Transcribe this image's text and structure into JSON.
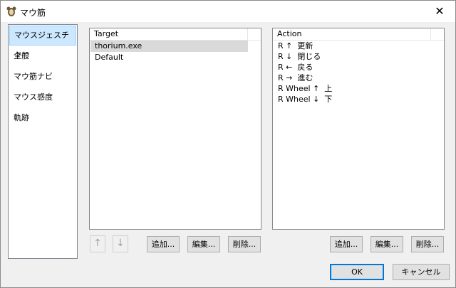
{
  "window": {
    "title": "マウ筋",
    "close_symbol": "✕",
    "icon": "mouse-app-icon"
  },
  "nav": {
    "items": [
      {
        "label": "マウスジェスチャー",
        "selected": true
      },
      {
        "label": "全般"
      },
      {
        "label": "マウ筋ナビ"
      },
      {
        "label": "マウス感度"
      },
      {
        "label": "軌跡"
      }
    ]
  },
  "targets": {
    "header": "Target",
    "rows": [
      "thorium.exe",
      "Default"
    ]
  },
  "actions": {
    "header": "Action",
    "rows": [
      "R ↑  更新",
      "R ↓  閉じる",
      "R ←  戻る",
      "R →  進む",
      "R Wheel ↑  上",
      "R Wheel ↓  下"
    ]
  },
  "target_buttons": {
    "up": "↑",
    "down": "↓",
    "add": "追加...",
    "edit": "編集...",
    "delete": "削除..."
  },
  "action_buttons": {
    "add": "追加...",
    "edit": "編集...",
    "delete": "削除..."
  },
  "footer": {
    "ok": "OK",
    "cancel": "キャンセル"
  }
}
